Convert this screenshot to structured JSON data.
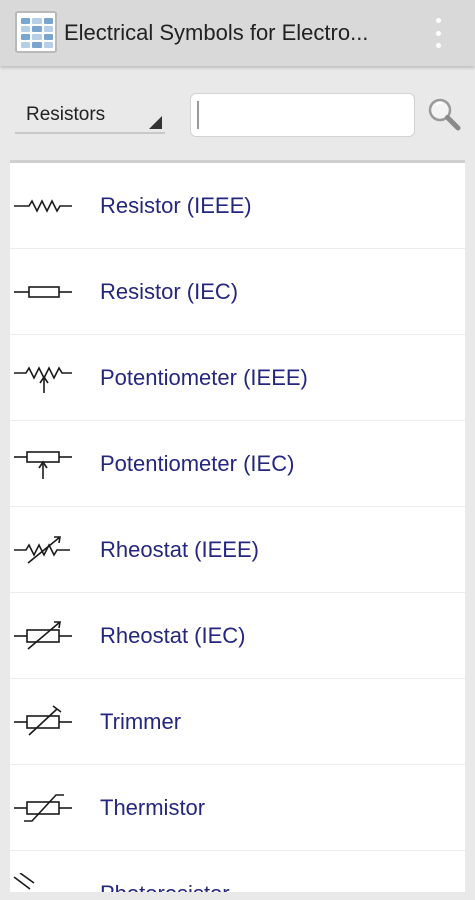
{
  "app": {
    "title": "Electrical Symbols for Electro...",
    "icon": "app-symbol-grid-icon",
    "menu_icon": "more-vert-icon"
  },
  "filter": {
    "category": "Resistors",
    "search_value": "",
    "search_icon": "search-icon"
  },
  "colors": {
    "appbar": "#d9d9d9",
    "background": "#e9e9e9",
    "item_text": "#25277f"
  },
  "items": [
    {
      "label": "Resistor (IEEE)",
      "icon": "resistor-ieee-icon"
    },
    {
      "label": "Resistor (IEC)",
      "icon": "resistor-iec-icon"
    },
    {
      "label": "Potentiometer (IEEE)",
      "icon": "potentiometer-ieee-icon"
    },
    {
      "label": "Potentiometer (IEC)",
      "icon": "potentiometer-iec-icon"
    },
    {
      "label": "Rheostat (IEEE)",
      "icon": "rheostat-ieee-icon"
    },
    {
      "label": "Rheostat (IEC)",
      "icon": "rheostat-iec-icon"
    },
    {
      "label": "Trimmer",
      "icon": "trimmer-icon"
    },
    {
      "label": "Thermistor",
      "icon": "thermistor-icon"
    },
    {
      "label": "Photoresistor",
      "icon": "photoresistor-icon"
    }
  ]
}
